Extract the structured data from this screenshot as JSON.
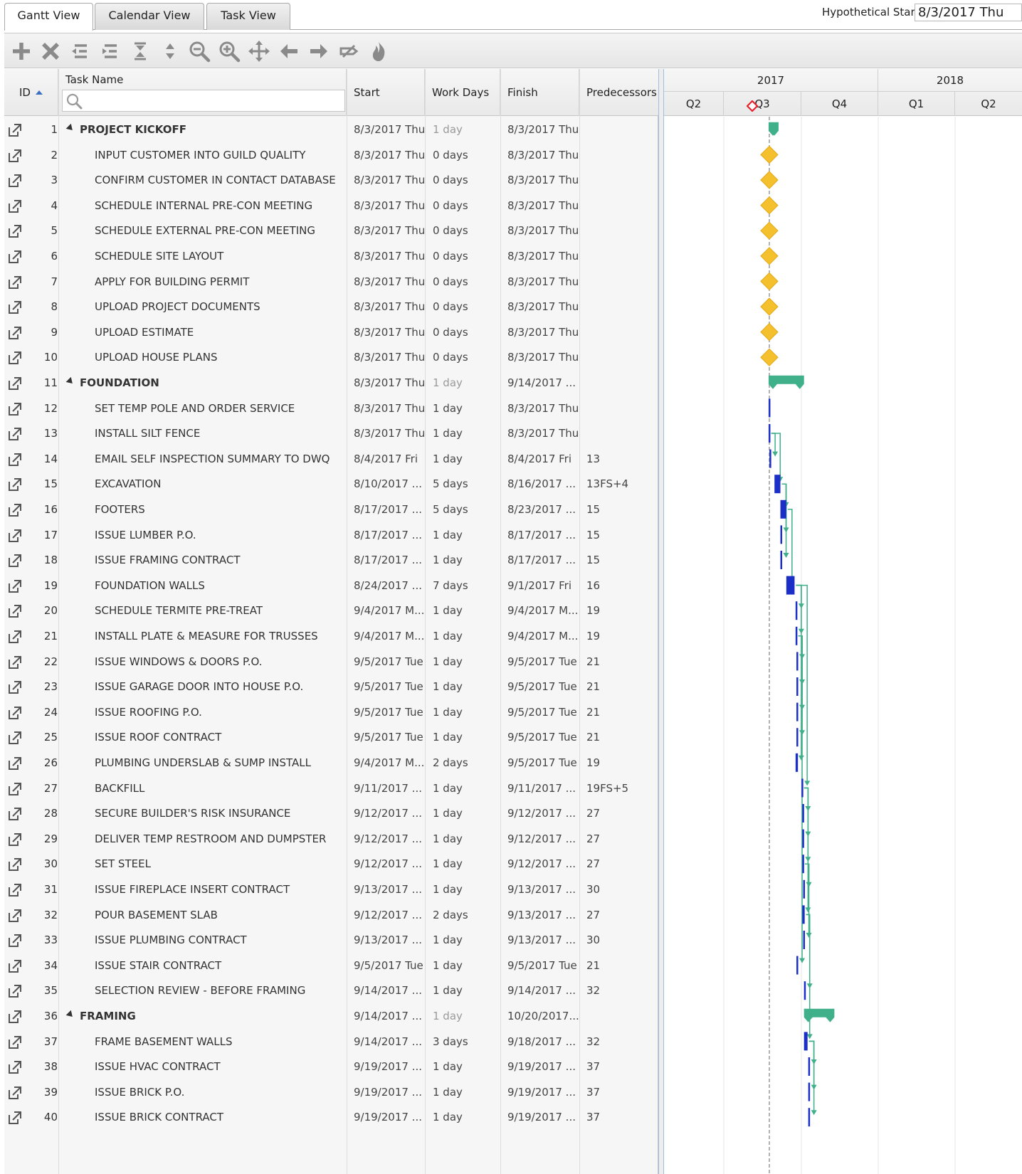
{
  "tabs": [
    {
      "label": "Gantt View",
      "active": true
    },
    {
      "label": "Calendar View",
      "active": false
    },
    {
      "label": "Task View",
      "active": false
    }
  ],
  "hypothetical_start": {
    "label": "Hypothetical Start:",
    "value": "8/3/2017 Thu"
  },
  "toolbar": [
    {
      "name": "add-task-button",
      "icon": "plus-icon"
    },
    {
      "name": "delete-task-button",
      "icon": "x-icon"
    },
    {
      "name": "outdent-button",
      "icon": "outdent-icon"
    },
    {
      "name": "indent-button",
      "icon": "indent-icon"
    },
    {
      "name": "collapse-all-button",
      "icon": "collapse-icon"
    },
    {
      "name": "expand-all-button",
      "icon": "expand-icon"
    },
    {
      "name": "zoom-out-button",
      "icon": "zoom-out-icon"
    },
    {
      "name": "zoom-in-button",
      "icon": "zoom-in-icon"
    },
    {
      "name": "fit-to-screen-button",
      "icon": "move-icon"
    },
    {
      "name": "scroll-left-button",
      "icon": "arrow-left-icon"
    },
    {
      "name": "scroll-right-button",
      "icon": "arrow-right-icon"
    },
    {
      "name": "toggle-links-button",
      "icon": "unlink-icon"
    },
    {
      "name": "critical-path-button",
      "icon": "flame-icon"
    }
  ],
  "columns": {
    "id": "ID",
    "name": "Task Name",
    "start": "Start",
    "days": "Work Days",
    "finish": "Finish",
    "pred": "Predecessors"
  },
  "timeline": {
    "years": [
      "2017",
      "2018"
    ],
    "quarters": [
      "Q2",
      "Q3",
      "Q4",
      "Q1",
      "Q2"
    ]
  },
  "colors": {
    "summary_bar": "#3fb08a",
    "milestone": "#f5c02e",
    "task_bar": "#1b2fc7",
    "link": "#3fb08a",
    "today_marker": "#e8222a"
  },
  "tasks": [
    {
      "id": "1",
      "name": "PROJECT KICKOFF",
      "summary": true,
      "start": "8/3/2017 Thu",
      "days": "1 day",
      "finish": "8/3/2017 Thu",
      "pred": ""
    },
    {
      "id": "2",
      "name": "INPUT CUSTOMER INTO GUILD QUALITY",
      "start": "8/3/2017 Thu",
      "days": "0 days",
      "finish": "8/3/2017 Thu",
      "pred": ""
    },
    {
      "id": "3",
      "name": "CONFIRM CUSTOMER IN CONTACT DATABASE",
      "start": "8/3/2017 Thu",
      "days": "0 days",
      "finish": "8/3/2017 Thu",
      "pred": ""
    },
    {
      "id": "4",
      "name": "SCHEDULE INTERNAL PRE-CON MEETING",
      "start": "8/3/2017 Thu",
      "days": "0 days",
      "finish": "8/3/2017 Thu",
      "pred": ""
    },
    {
      "id": "5",
      "name": "SCHEDULE EXTERNAL PRE-CON MEETING",
      "start": "8/3/2017 Thu",
      "days": "0 days",
      "finish": "8/3/2017 Thu",
      "pred": ""
    },
    {
      "id": "6",
      "name": "SCHEDULE SITE LAYOUT",
      "start": "8/3/2017 Thu",
      "days": "0 days",
      "finish": "8/3/2017 Thu",
      "pred": ""
    },
    {
      "id": "7",
      "name": "APPLY FOR BUILDING PERMIT",
      "start": "8/3/2017 Thu",
      "days": "0 days",
      "finish": "8/3/2017 Thu",
      "pred": ""
    },
    {
      "id": "8",
      "name": "UPLOAD PROJECT DOCUMENTS",
      "start": "8/3/2017 Thu",
      "days": "0 days",
      "finish": "8/3/2017 Thu",
      "pred": ""
    },
    {
      "id": "9",
      "name": "UPLOAD ESTIMATE",
      "start": "8/3/2017 Thu",
      "days": "0 days",
      "finish": "8/3/2017 Thu",
      "pred": ""
    },
    {
      "id": "10",
      "name": "UPLOAD HOUSE PLANS",
      "start": "8/3/2017 Thu",
      "days": "0 days",
      "finish": "8/3/2017 Thu",
      "pred": ""
    },
    {
      "id": "11",
      "name": "FOUNDATION",
      "summary": true,
      "start": "8/3/2017 Thu",
      "days": "1 day",
      "finish": "9/14/2017 ...",
      "pred": ""
    },
    {
      "id": "12",
      "name": "SET TEMP POLE AND ORDER SERVICE",
      "start": "8/3/2017 Thu",
      "days": "1 day",
      "finish": "8/3/2017 Thu",
      "pred": ""
    },
    {
      "id": "13",
      "name": "INSTALL SILT FENCE",
      "start": "8/3/2017 Thu",
      "days": "1 day",
      "finish": "8/3/2017 Thu",
      "pred": ""
    },
    {
      "id": "14",
      "name": "EMAIL SELF INSPECTION SUMMARY TO DWQ",
      "start": "8/4/2017 Fri",
      "days": "1 day",
      "finish": "8/4/2017 Fri",
      "pred": "13"
    },
    {
      "id": "15",
      "name": "EXCAVATION",
      "start": "8/10/2017 ...",
      "days": "5 days",
      "finish": "8/16/2017 ...",
      "pred": "13FS+4"
    },
    {
      "id": "16",
      "name": "FOOTERS",
      "start": "8/17/2017 ...",
      "days": "5 days",
      "finish": "8/23/2017 ...",
      "pred": "15"
    },
    {
      "id": "17",
      "name": "ISSUE LUMBER P.O.",
      "start": "8/17/2017 ...",
      "days": "1 day",
      "finish": "8/17/2017 ...",
      "pred": "15"
    },
    {
      "id": "18",
      "name": "ISSUE FRAMING CONTRACT",
      "start": "8/17/2017 ...",
      "days": "1 day",
      "finish": "8/17/2017 ...",
      "pred": "15"
    },
    {
      "id": "19",
      "name": "FOUNDATION WALLS",
      "start": "8/24/2017 ...",
      "days": "7 days",
      "finish": "9/1/2017 Fri",
      "pred": "16"
    },
    {
      "id": "20",
      "name": "SCHEDULE TERMITE PRE-TREAT",
      "start": "9/4/2017 M...",
      "days": "1 day",
      "finish": "9/4/2017 M...",
      "pred": "19"
    },
    {
      "id": "21",
      "name": "INSTALL PLATE & MEASURE FOR TRUSSES",
      "start": "9/4/2017 M...",
      "days": "1 day",
      "finish": "9/4/2017 M...",
      "pred": "19"
    },
    {
      "id": "22",
      "name": "ISSUE WINDOWS & DOORS P.O.",
      "start": "9/5/2017 Tue",
      "days": "1 day",
      "finish": "9/5/2017 Tue",
      "pred": "21"
    },
    {
      "id": "23",
      "name": "ISSUE GARAGE DOOR INTO HOUSE P.O.",
      "start": "9/5/2017 Tue",
      "days": "1 day",
      "finish": "9/5/2017 Tue",
      "pred": "21"
    },
    {
      "id": "24",
      "name": "ISSUE ROOFING P.O.",
      "start": "9/5/2017 Tue",
      "days": "1 day",
      "finish": "9/5/2017 Tue",
      "pred": "21"
    },
    {
      "id": "25",
      "name": "ISSUE ROOF CONTRACT",
      "start": "9/5/2017 Tue",
      "days": "1 day",
      "finish": "9/5/2017 Tue",
      "pred": "21"
    },
    {
      "id": "26",
      "name": "PLUMBING UNDERSLAB & SUMP INSTALL",
      "start": "9/4/2017 M...",
      "days": "2 days",
      "finish": "9/5/2017 Tue",
      "pred": "19"
    },
    {
      "id": "27",
      "name": "BACKFILL",
      "start": "9/11/2017 ...",
      "days": "1 day",
      "finish": "9/11/2017 ...",
      "pred": "19FS+5"
    },
    {
      "id": "28",
      "name": "SECURE BUILDER'S RISK INSURANCE",
      "start": "9/12/2017 ...",
      "days": "1 day",
      "finish": "9/12/2017 ...",
      "pred": "27"
    },
    {
      "id": "29",
      "name": "DELIVER TEMP RESTROOM AND DUMPSTER",
      "start": "9/12/2017 ...",
      "days": "1 day",
      "finish": "9/12/2017 ...",
      "pred": "27"
    },
    {
      "id": "30",
      "name": "SET STEEL",
      "start": "9/12/2017 ...",
      "days": "1 day",
      "finish": "9/12/2017 ...",
      "pred": "27"
    },
    {
      "id": "31",
      "name": "ISSUE FIREPLACE INSERT CONTRACT",
      "start": "9/13/2017 ...",
      "days": "1 day",
      "finish": "9/13/2017 ...",
      "pred": "30"
    },
    {
      "id": "32",
      "name": "POUR BASEMENT SLAB",
      "start": "9/12/2017 ...",
      "days": "2 days",
      "finish": "9/13/2017 ...",
      "pred": "27"
    },
    {
      "id": "33",
      "name": "ISSUE PLUMBING CONTRACT",
      "start": "9/13/2017 ...",
      "days": "1 day",
      "finish": "9/13/2017 ...",
      "pred": "30"
    },
    {
      "id": "34",
      "name": "ISSUE STAIR CONTRACT",
      "start": "9/5/2017 Tue",
      "days": "1 day",
      "finish": "9/5/2017 Tue",
      "pred": "21"
    },
    {
      "id": "35",
      "name": "SELECTION REVIEW - BEFORE FRAMING",
      "start": "9/14/2017 ...",
      "days": "1 day",
      "finish": "9/14/2017 ...",
      "pred": "32"
    },
    {
      "id": "36",
      "name": "FRAMING",
      "summary": true,
      "start": "9/14/2017 ...",
      "days": "1 day",
      "finish": "10/20/2017...",
      "pred": ""
    },
    {
      "id": "37",
      "name": "FRAME BASEMENT WALLS",
      "start": "9/14/2017 ...",
      "days": "3 days",
      "finish": "9/18/2017 ...",
      "pred": "32"
    },
    {
      "id": "38",
      "name": "ISSUE HVAC CONTRACT",
      "start": "9/19/2017 ...",
      "days": "1 day",
      "finish": "9/19/2017 ...",
      "pred": "37"
    },
    {
      "id": "39",
      "name": "ISSUE BRICK P.O.",
      "start": "9/19/2017 ...",
      "days": "1 day",
      "finish": "9/19/2017 ...",
      "pred": "37"
    },
    {
      "id": "40",
      "name": "ISSUE BRICK CONTRACT",
      "start": "9/19/2017 ...",
      "days": "1 day",
      "finish": "9/19/2017 ...",
      "pred": "37"
    }
  ]
}
